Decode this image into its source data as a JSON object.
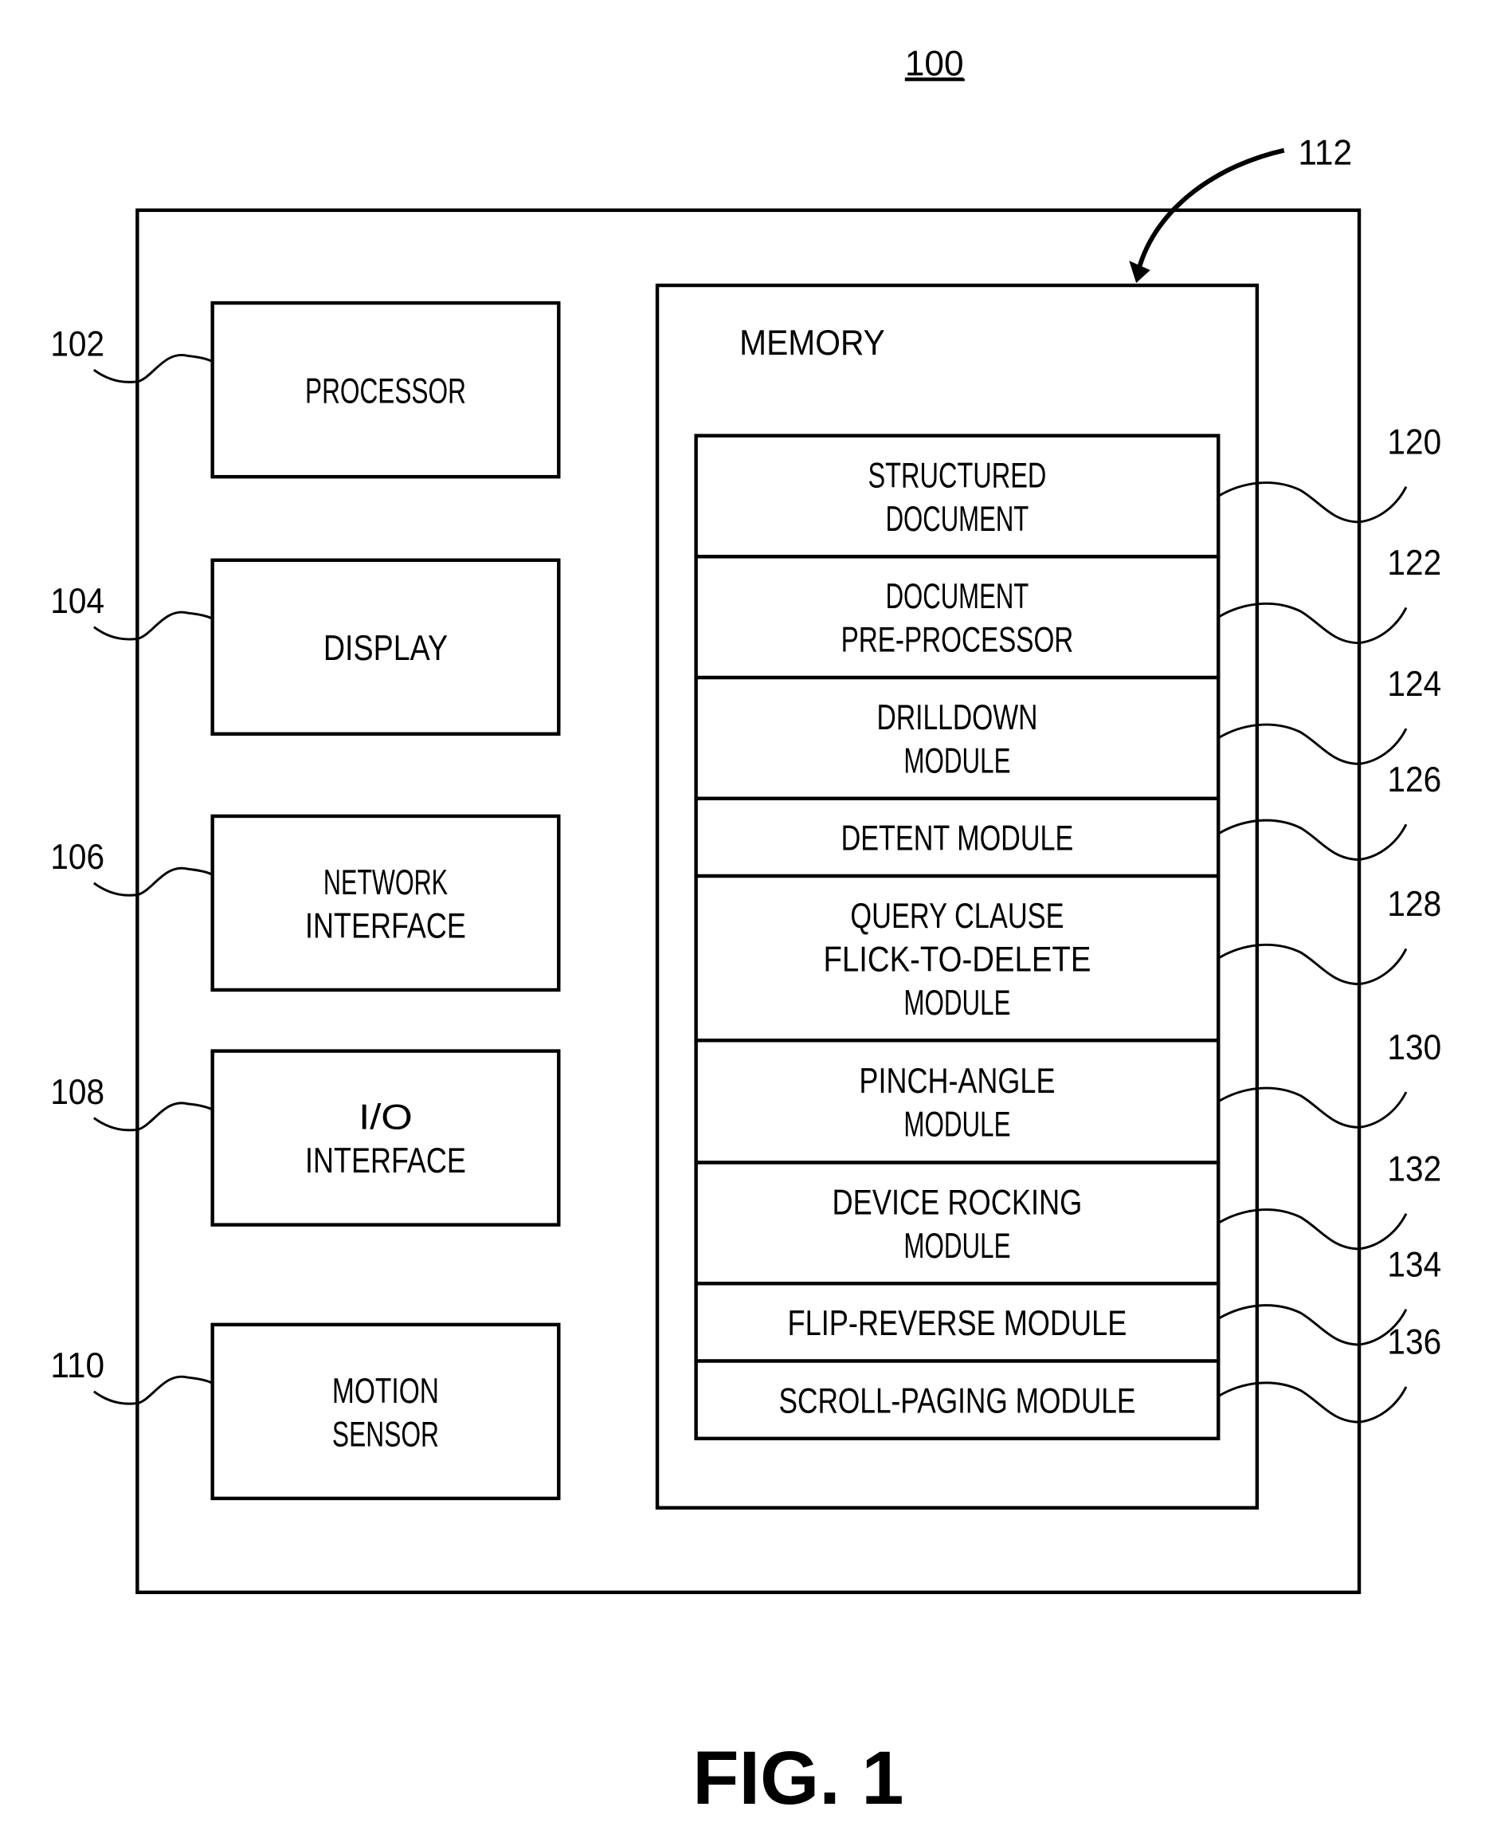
{
  "figure": {
    "system_ref": "100",
    "caption": "FIG. 1",
    "memory_ref": "112",
    "memory_label": "MEMORY"
  },
  "components": [
    {
      "ref": "102",
      "lines": [
        "PROCESSOR"
      ]
    },
    {
      "ref": "104",
      "lines": [
        "DISPLAY"
      ]
    },
    {
      "ref": "106",
      "lines": [
        "NETWORK",
        "INTERFACE"
      ]
    },
    {
      "ref": "108",
      "lines": [
        "I/O",
        "INTERFACE"
      ]
    },
    {
      "ref": "110",
      "lines": [
        "MOTION",
        "SENSOR"
      ]
    }
  ],
  "memory_modules": [
    {
      "ref": "120",
      "lines": [
        "STRUCTURED",
        "DOCUMENT"
      ]
    },
    {
      "ref": "122",
      "lines": [
        "DOCUMENT",
        "PRE-PROCESSOR"
      ]
    },
    {
      "ref": "124",
      "lines": [
        "DRILLDOWN",
        "MODULE"
      ]
    },
    {
      "ref": "126",
      "lines": [
        "DETENT MODULE"
      ]
    },
    {
      "ref": "128",
      "lines": [
        "QUERY CLAUSE",
        "FLICK-TO-DELETE",
        "MODULE"
      ]
    },
    {
      "ref": "130",
      "lines": [
        "PINCH-ANGLE",
        "MODULE"
      ]
    },
    {
      "ref": "132",
      "lines": [
        "DEVICE ROCKING",
        "MODULE"
      ]
    },
    {
      "ref": "134",
      "lines": [
        "FLIP-REVERSE MODULE"
      ]
    },
    {
      "ref": "136",
      "lines": [
        "SCROLL-PAGING MODULE"
      ]
    }
  ]
}
